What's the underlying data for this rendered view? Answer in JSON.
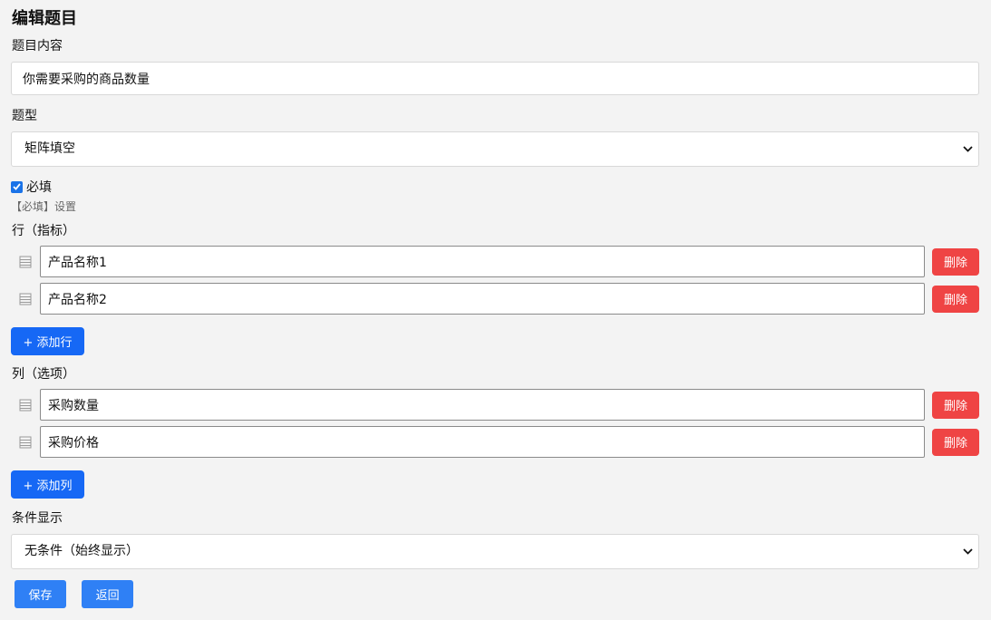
{
  "header": {
    "title": "编辑题目"
  },
  "question": {
    "label": "题目内容",
    "value": "你需要采购的商品数量"
  },
  "type": {
    "label": "题型",
    "selected": "矩阵填空"
  },
  "required": {
    "label": "必填",
    "checked": true,
    "hint": "【必填】设置"
  },
  "rows": {
    "label": "行（指标）",
    "items": [
      "产品名称1",
      "产品名称2"
    ],
    "delete_label": "删除",
    "add_label": "+ 添加行"
  },
  "columns": {
    "label": "列（选项）",
    "items": [
      "采购数量",
      "采购价格"
    ],
    "delete_label": "删除",
    "add_label": "+ 添加列"
  },
  "condition": {
    "label": "条件显示",
    "selected": "无条件（始终显示）"
  },
  "actions": {
    "save_label": "保存",
    "back_label": "返回"
  },
  "colors": {
    "primary": "#1668f5",
    "danger": "#ef4444",
    "background": "#f3f3f3"
  }
}
